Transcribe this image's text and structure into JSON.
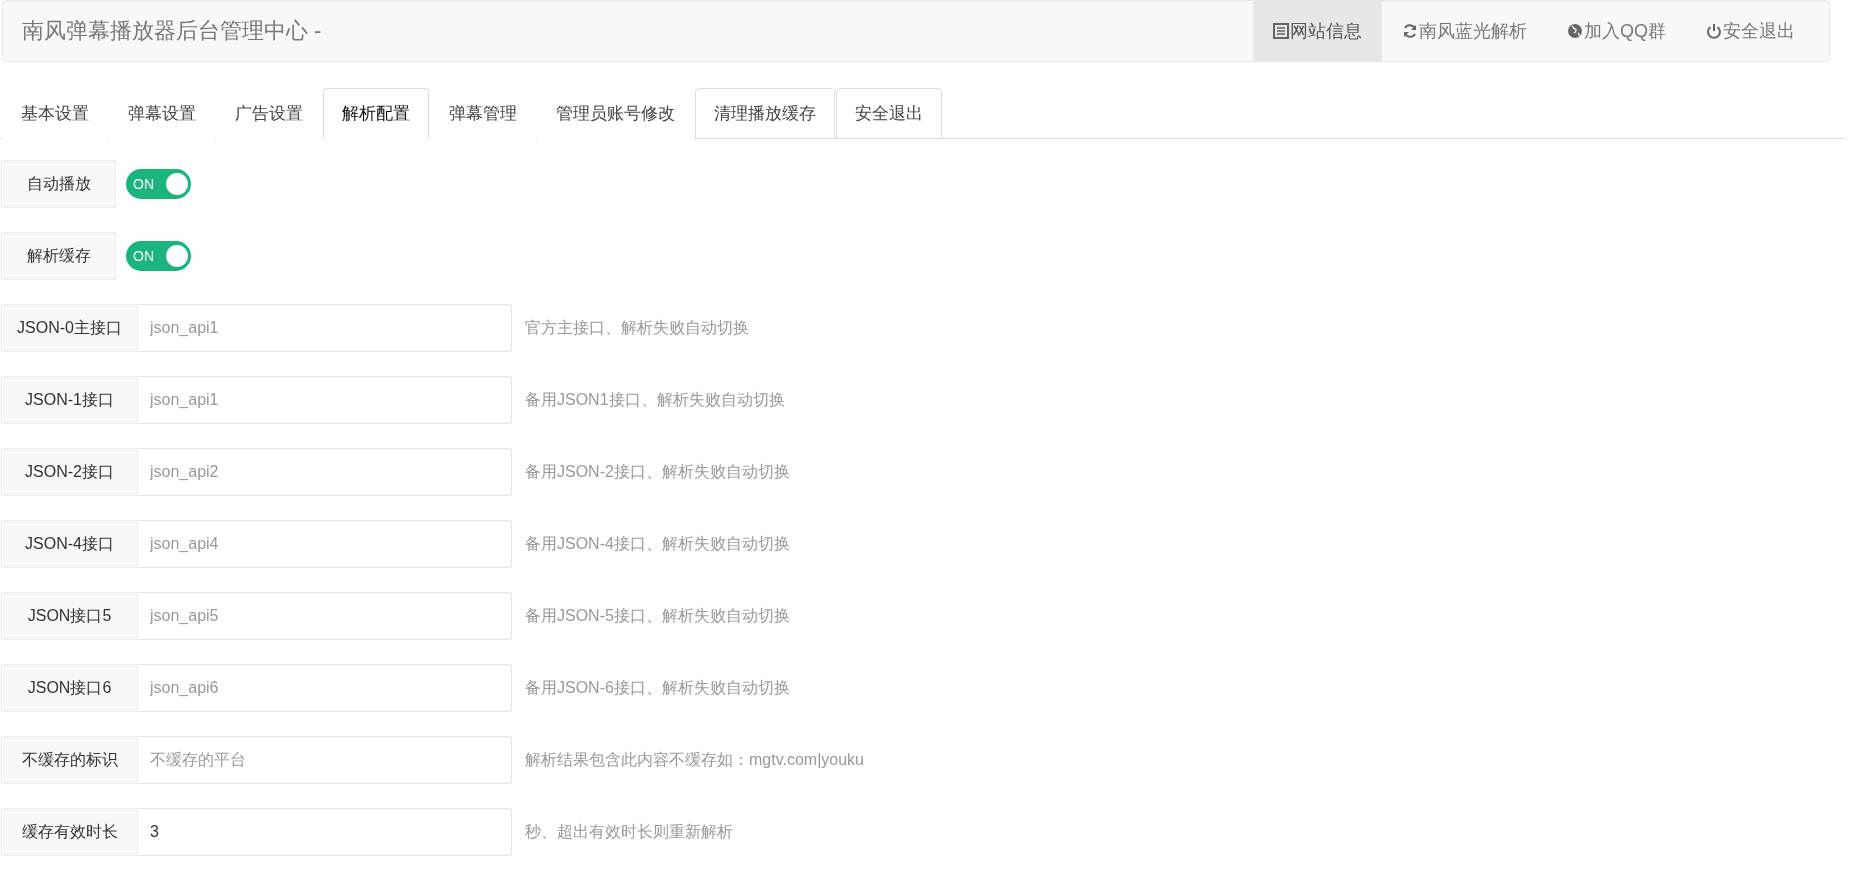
{
  "header": {
    "title": "南风弹幕播放器后台管理中心 -",
    "nav": [
      {
        "label": "网站信息",
        "selected": true
      },
      {
        "label": "南风蓝光解析",
        "selected": false
      },
      {
        "label": "加入QQ群",
        "selected": false
      },
      {
        "label": "安全退出",
        "selected": false
      }
    ]
  },
  "tabs": [
    {
      "label": "基本设置",
      "selected": false,
      "outlined": false
    },
    {
      "label": "弹幕设置",
      "selected": false,
      "outlined": false
    },
    {
      "label": "广告设置",
      "selected": false,
      "outlined": false
    },
    {
      "label": "解析配置",
      "selected": true,
      "outlined": true
    },
    {
      "label": "弹幕管理",
      "selected": false,
      "outlined": false
    },
    {
      "label": "管理员账号修改",
      "selected": false,
      "outlined": false
    },
    {
      "label": "清理播放缓存",
      "selected": false,
      "outlined": true
    },
    {
      "label": "安全退出",
      "selected": false,
      "outlined": true
    }
  ],
  "form": [
    {
      "kind": "switch",
      "label": "自动播放",
      "on": true,
      "switch_text": "ON"
    },
    {
      "kind": "switch",
      "label": "解析缓存",
      "on": true,
      "switch_text": "ON"
    },
    {
      "kind": "text",
      "label": "JSON-0主接口",
      "placeholder": "json_api1",
      "hint": "官方主接口、解析失败自动切换"
    },
    {
      "kind": "text",
      "label": "JSON-1接口",
      "placeholder": "json_api1",
      "hint": "备用JSON1接口、解析失败自动切换"
    },
    {
      "kind": "text",
      "label": "JSON-2接口",
      "placeholder": "json_api2",
      "hint": "备用JSON-2接口、解析失败自动切换"
    },
    {
      "kind": "text",
      "label": "JSON-4接口",
      "placeholder": "json_api4",
      "hint": "备用JSON-4接口、解析失败自动切换"
    },
    {
      "kind": "text",
      "label": "JSON接口5",
      "placeholder": "json_api5",
      "hint": "备用JSON-5接口、解析失败自动切换"
    },
    {
      "kind": "text",
      "label": "JSON接口6",
      "placeholder": "json_api6",
      "hint": "备用JSON-6接口、解析失败自动切换"
    },
    {
      "kind": "text",
      "label": "不缓存的标识",
      "placeholder": "不缓存的平台",
      "hint": "解析结果包含此内容不缓存如：mgtv.com|youku"
    },
    {
      "kind": "text",
      "label": "缓存有效时长",
      "value": "3",
      "hint": "秒、超出有效时长则重新解析"
    }
  ]
}
